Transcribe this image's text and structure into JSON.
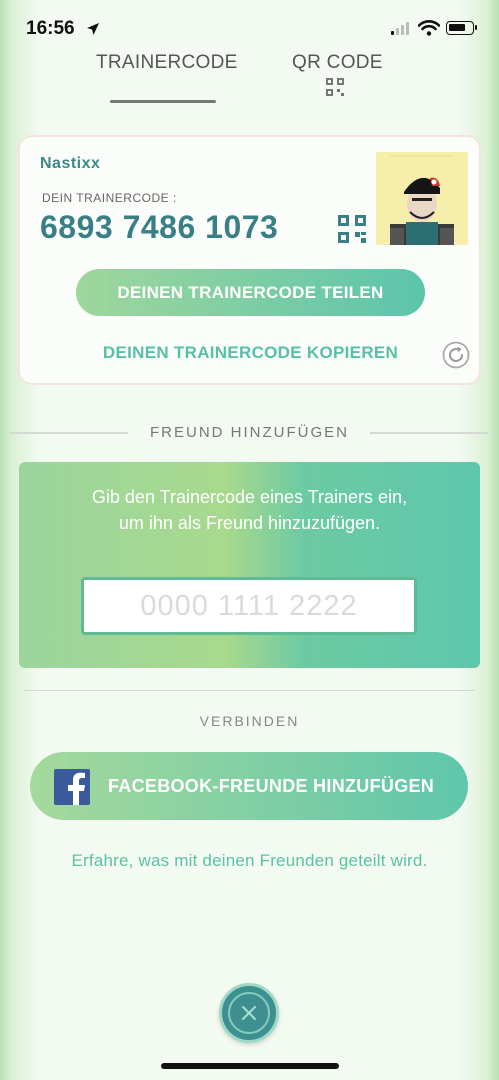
{
  "status_bar": {
    "time": "16:56"
  },
  "tabs": [
    {
      "label": "TRAINERCODE",
      "active": true
    },
    {
      "label": "QR CODE",
      "active": false
    }
  ],
  "trainer_card": {
    "username": "Nastixx",
    "code_label": "DEIN TRAINERCODE :",
    "code_value": "6893 7486 1073",
    "share_button": "DEINEN TRAINERCODE TEILEN",
    "copy_link": "DEINEN TRAINERCODE KOPIEREN"
  },
  "add_friend": {
    "section_title": "FREUND HINZUFÜGEN",
    "instruction": "Gib den Trainercode eines Trainers ein, um ihn als Freund hinzuzufügen.",
    "input_placeholder": "0000 1111 2222",
    "input_value": ""
  },
  "connect": {
    "section_title": "VERBINDEN",
    "facebook_button": "FACEBOOK-FREUNDE HINZUFÜGEN",
    "info_link": "Erfahre, was mit deinen Freunden geteilt wird."
  },
  "icons": {
    "status": [
      "location-arrow-icon",
      "signal-icon",
      "wifi-icon",
      "battery-icon"
    ],
    "tab_qr": "qr-code-icon",
    "card": [
      "qr-code-icon",
      "refresh-icon"
    ],
    "facebook": "facebook-icon",
    "close": "close-icon"
  },
  "colors": {
    "accent_teal": "#3a7f86",
    "accent_green": "#57c0a6",
    "button_gradient_start": "#9fd79c",
    "button_gradient_end": "#5cc4ac",
    "facebook_blue": "#3b5a9c"
  }
}
